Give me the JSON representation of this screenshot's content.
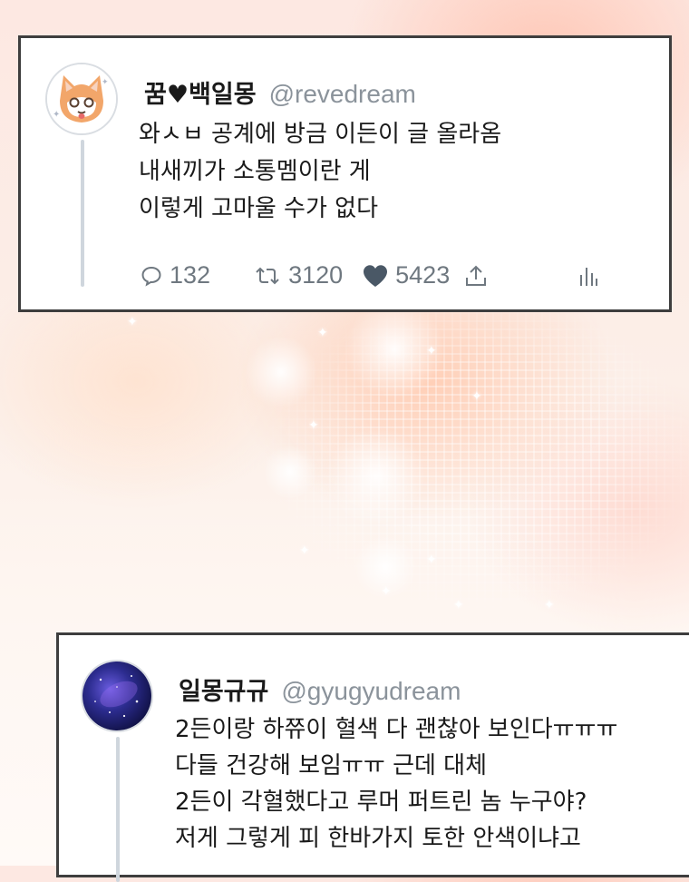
{
  "posts": [
    {
      "name": "꿈♥백일몽",
      "handle": "@revedream",
      "lines": [
        "와ㅅㅂ 공계에 방금 이든이 글 올라옴",
        "내새끼가 소통멤이란 게",
        "이렇게 고마울 수가 없다"
      ],
      "replies": "132",
      "retweets": "3120",
      "likes": "5423",
      "avatar_icon": "cat-avatar-icon"
    },
    {
      "name": "일몽규규",
      "handle": "@gyugyudream",
      "lines": [
        "2든이랑 하쮸이 혈색 다 괜찮아 보인다ㅠㅠㅠ",
        "다들 건강해 보임ㅠㅠ 근데 대체",
        "2든이 각혈했다고 루머 퍼트린 놈 누구야?",
        "저게 그렇게 피 한바가지 토한 안색이냐고"
      ],
      "avatar_icon": "galaxy-avatar-icon"
    }
  ],
  "colors": {
    "card_border": "#3e3e3e",
    "icon_gray": "#6f7880",
    "handle_gray": "#8b939b",
    "like_heart": "#4a5866"
  }
}
